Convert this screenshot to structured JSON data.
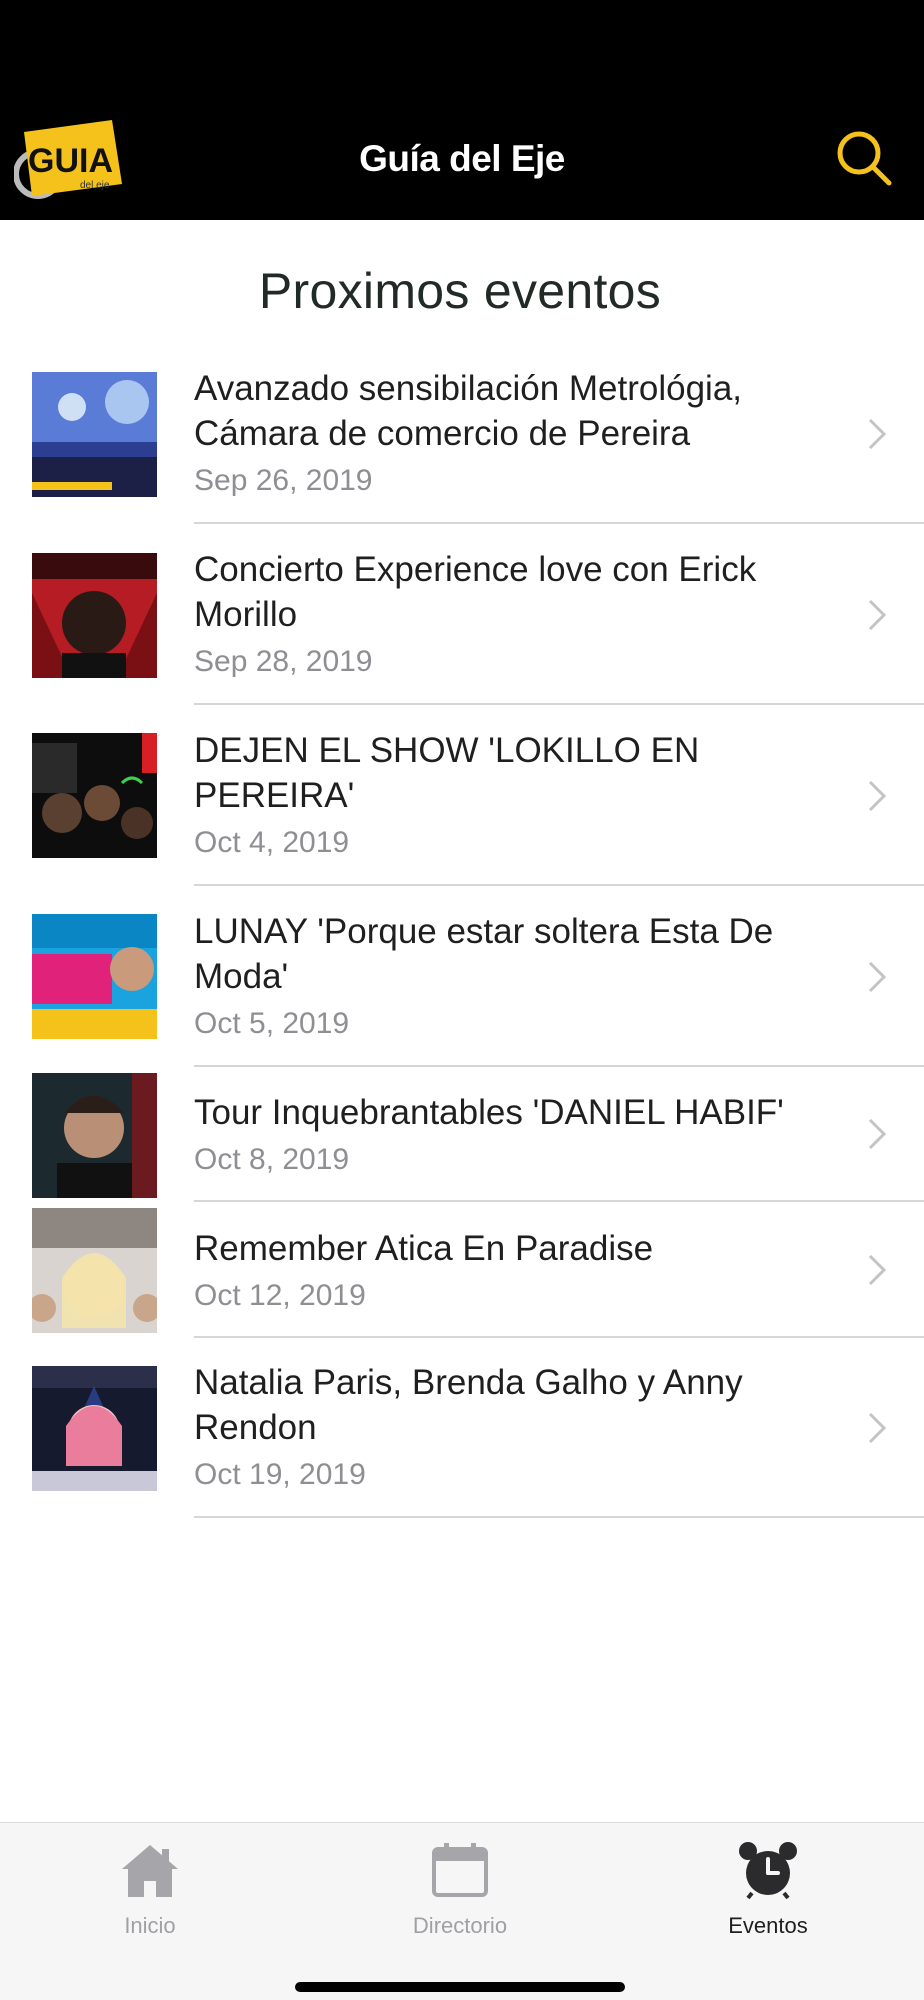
{
  "header": {
    "title": "Guía del Eje",
    "logo_text": "GUIA",
    "logo_subtext": "del eje",
    "search_icon": "search-icon",
    "accent_color": "#f4c21b"
  },
  "section": {
    "title": "Proximos eventos"
  },
  "events": [
    {
      "title": "Avanzado sensibilación Metrológia, Cámara de comercio de Pereira",
      "date": "Sep 26, 2019"
    },
    {
      "title": "Concierto Experience love con Erick Morillo",
      "date": "Sep 28, 2019"
    },
    {
      "title": "DEJEN EL SHOW 'LOKILLO EN PEREIRA'",
      "date": "Oct 4, 2019"
    },
    {
      "title": "LUNAY 'Porque estar soltera Esta De Moda'",
      "date": "Oct 5, 2019"
    },
    {
      "title": "Tour Inquebrantables 'DANIEL HABIF'",
      "date": "Oct 8, 2019"
    },
    {
      "title": "Remember Atica En Paradise",
      "date": "Oct 12, 2019"
    },
    {
      "title": "Natalia Paris, Brenda Galho y Anny Rendon",
      "date": "Oct 19, 2019"
    }
  ],
  "tabs": [
    {
      "label": "Inicio",
      "icon": "home-icon",
      "active": false
    },
    {
      "label": "Directorio",
      "icon": "calendar-icon",
      "active": false
    },
    {
      "label": "Eventos",
      "icon": "alarm-clock-icon",
      "active": true
    }
  ]
}
